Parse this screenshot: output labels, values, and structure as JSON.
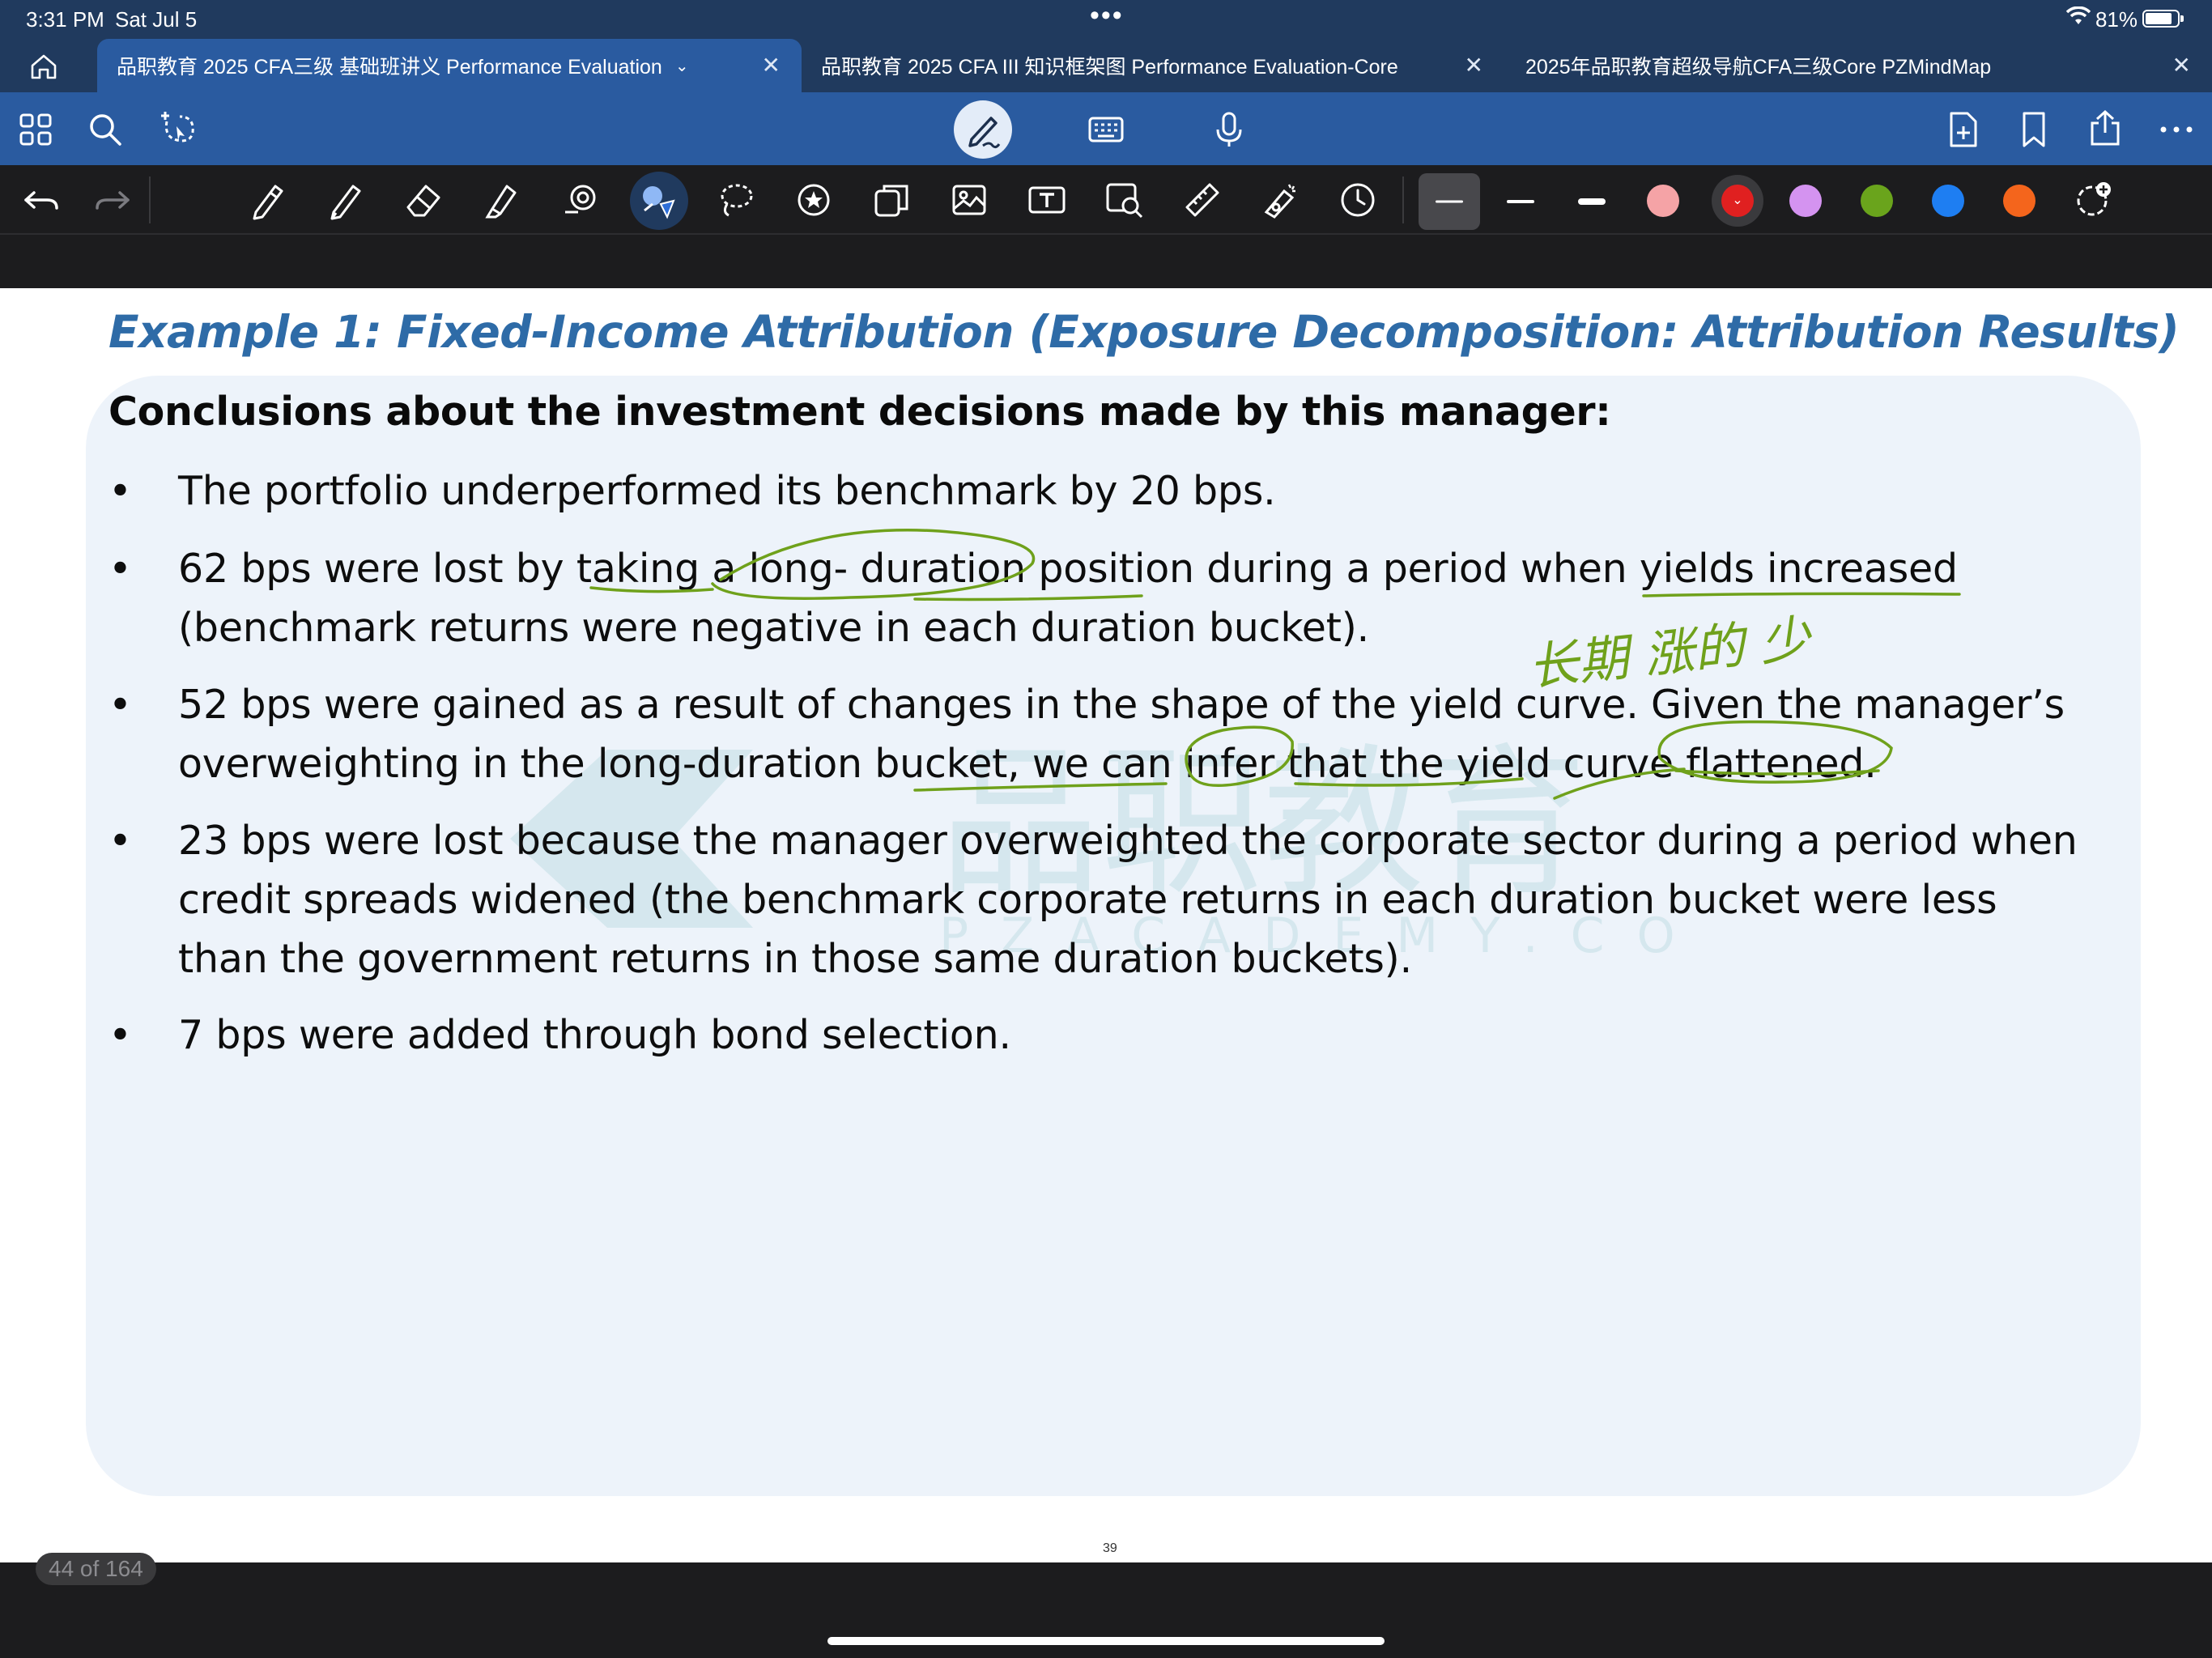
{
  "status_bar": {
    "time": "3:31 PM",
    "date": "Sat Jul 5",
    "battery": "81%",
    "more": "•••"
  },
  "tabs": [
    {
      "label": "品职教育 2025 CFA三级 基础班讲义 Performance Evaluation",
      "chevron": "⌄",
      "close": "✕",
      "active": true
    },
    {
      "label": "品职教育 2025 CFA III 知识框架图 Performance Evaluation-Core",
      "close": "✕",
      "active": false
    },
    {
      "label": "2025年品职教育超级导航CFA三级Core PZMindMap",
      "close": "✕",
      "active": false
    }
  ],
  "toolbar_icons": [
    "grid-icon",
    "search-icon",
    "lasso-pointer-icon",
    "pen-mode-icon",
    "keyboard-icon",
    "microphone-icon",
    "add-page-icon",
    "bookmark-icon",
    "share-icon",
    "more-icon"
  ],
  "tools": [
    "undo",
    "redo",
    "pen",
    "pencil",
    "eraser",
    "highlighter",
    "shapes",
    "laser-pointer",
    "lasso",
    "sticker",
    "element",
    "image",
    "text",
    "zoom-image",
    "ruler",
    "tape",
    "timer"
  ],
  "colors": {
    "pink": "#f5a3a6",
    "red": "#e02020",
    "lilac": "#d493f0",
    "green": "#6aa41c",
    "blue": "#1e7ef2",
    "orange": "#f4651c",
    "ink": "#6fa11b",
    "title": "#2e6ba7"
  },
  "slide": {
    "title": "Example 1: Fixed-Income Attribution (Exposure Decomposition: Attribution Results)",
    "heading": "Conclusions about the investment decisions made by this manager:",
    "bullet_symbol": "•",
    "bullets": [
      {
        "lines": [
          "The portfolio underperformed its benchmark by 20 bps."
        ]
      },
      {
        "lines": [
          "62 bps were lost by taking a long- duration position during a period when yields increased",
          "(benchmark returns were negative in each duration bucket)."
        ]
      },
      {
        "lines": [
          "52 bps were gained as a result of changes in the shape of the yield curve. Given the manager’s",
          "overweighting in the long-duration bucket, we can infer that the yield curve flattened."
        ]
      },
      {
        "lines": [
          "23 bps were lost because the manager overweighted the corporate sector during a period when",
          "credit spreads widened (the benchmark corporate returns in each duration bucket were less",
          "than the government returns in those same duration buckets)."
        ]
      },
      {
        "lines": [
          "7 bps were added through bond selection."
        ]
      }
    ],
    "handwritten_note": "长期 涨的 少",
    "watermark": "品职教育",
    "watermark_url": "PZACADEMY.COM",
    "page_number": "39"
  },
  "page_counter": "44 of 164"
}
